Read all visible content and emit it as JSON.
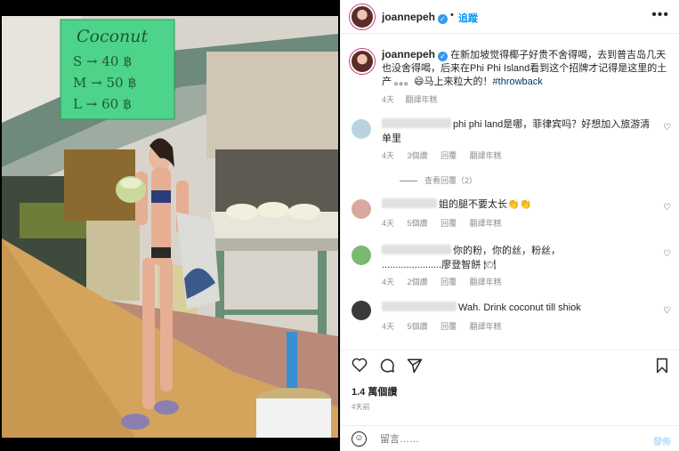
{
  "header": {
    "username": "joannepeh",
    "separator": "•",
    "follow_label": "追蹤",
    "more_label": "•••"
  },
  "caption": {
    "username": "joannepeh",
    "text": "在新加坡觉得椰子好贵不舍得喝，去到普吉岛几天也没舍得喝，后来在Phi Phi Island看到这个招牌才记得是这里的土产 。。。😄马上来粒大的！",
    "hashtag": "#throwback",
    "time": "4天",
    "translate": "翻譯年糕"
  },
  "photo_sign": {
    "title": "Coconut",
    "line1": "S → 40 ฿",
    "line2": "M → 50 ฿",
    "line3": "L → 60 ฿"
  },
  "comments": [
    {
      "text": "phi phi land是哪，菲律宾吗？好想加入旅游清单里",
      "meta_time": "4天",
      "meta_likes": "3個讚",
      "meta_reply": "回覆",
      "meta_translate": "翻譯年糕",
      "avatar_color": "#b9d3e0"
    },
    {
      "text": "姐的腿不要太长👏👏",
      "meta_time": "4天",
      "meta_likes": "5個讚",
      "meta_reply": "回覆",
      "meta_translate": "翻譯年糕",
      "avatar_color": "#d9a9a0"
    },
    {
      "text_line1": "你的粉，你的丝，粉丝，",
      "text_line2": "......................廖登智餅 🍽",
      "meta_time": "4天",
      "meta_likes": "2個讚",
      "meta_reply": "回覆",
      "meta_translate": "翻譯年糕",
      "avatar_color": "#7bb872"
    },
    {
      "text": "Wah. Drink coconut till shiok",
      "meta_time": "4天",
      "meta_likes": "5個讚",
      "meta_reply": "回覆",
      "meta_translate": "翻譯年糕",
      "avatar_color": "#3a3a3a"
    }
  ],
  "view_replies": "查看回覆（2）",
  "actions": {
    "like_icon": "heart-icon",
    "comment_icon": "comment-icon",
    "share_icon": "share-icon",
    "save_icon": "bookmark-icon"
  },
  "likes": "1.4 萬個讚",
  "time_ago": "4天前",
  "comment_input": {
    "placeholder": "留言……",
    "post_label": "發佈"
  }
}
